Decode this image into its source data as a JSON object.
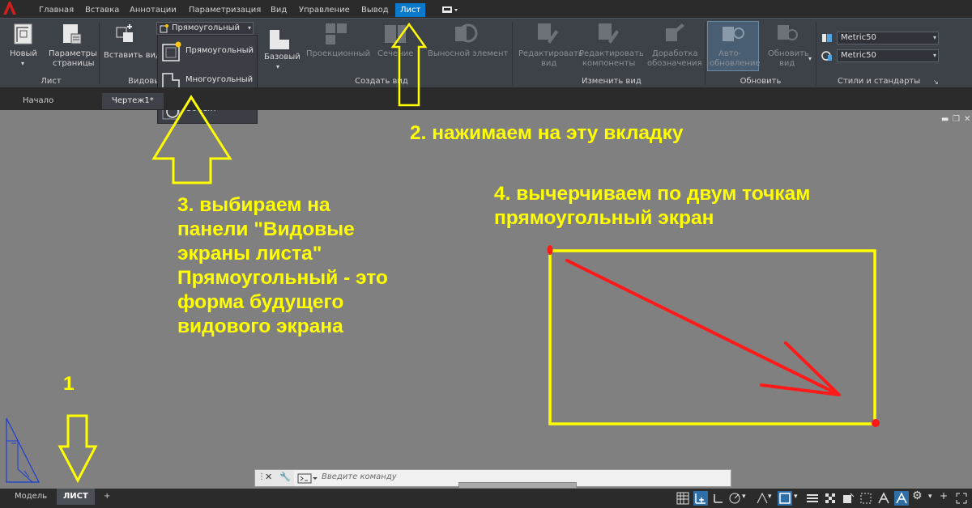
{
  "menu": {
    "tabs": [
      "Главная",
      "Вставка",
      "Аннотации",
      "Параметризация",
      "Вид",
      "Управление",
      "Вывод",
      "Лист"
    ],
    "active": "Лист"
  },
  "ribbon": {
    "panels": {
      "sheet": "Лист",
      "viewports": "Видовы",
      "create_view": "Создать вид",
      "modify_view": "Изменить вид",
      "update": "Обновить",
      "styles": "Стили и стандарты"
    },
    "buttons": {
      "new": "Новый",
      "page_setup_1": "Параметры",
      "page_setup_2": "страницы",
      "insert_view": "Вставить вид",
      "viewport_combo": "Прямоугольный",
      "base": "Базовый",
      "projected": "Проекционный",
      "section": "Сечение",
      "detail": "Выносной элемент",
      "edit_view_1": "Редактировать",
      "edit_view_2": "вид",
      "edit_comp_1": "Редактировать",
      "edit_comp_2": "компоненты",
      "symbol_sketch_1": "Доработка",
      "symbol_sketch_2": "обозначения",
      "auto_update_1": "Авто-",
      "auto_update_2": "обновление",
      "update_view_1": "Обновить",
      "update_view_2": "вид"
    },
    "styles": {
      "combo1": "Metric50",
      "combo2": "Metric50"
    }
  },
  "dropdown": {
    "items": [
      "Прямоугольный",
      "Многоугольный",
      "Объект"
    ]
  },
  "file_tabs": {
    "start": "Начало",
    "drawing": "Чертеж1*"
  },
  "annotations": {
    "step1": "1",
    "step2": "2. нажимаем на эту вкладку",
    "step3_lines": [
      "3. выбираем на",
      "панели \"Видовые",
      "экраны листа\"",
      "Прямоугольный - это",
      "форма будущего",
      "видового экрана"
    ],
    "step4_lines": [
      "4. вычерчиваем по двум точкам",
      "прямоугольный экран"
    ]
  },
  "command_line": {
    "placeholder": "Введите команду"
  },
  "layout_tabs": {
    "model": "Модель",
    "sheet": "ЛИСТ",
    "add": "+"
  },
  "colors": {
    "annotation": "#ffff00",
    "arrow_red": "#ff1a1a",
    "active_tab": "#0a7acc",
    "canvas": "#808080"
  }
}
